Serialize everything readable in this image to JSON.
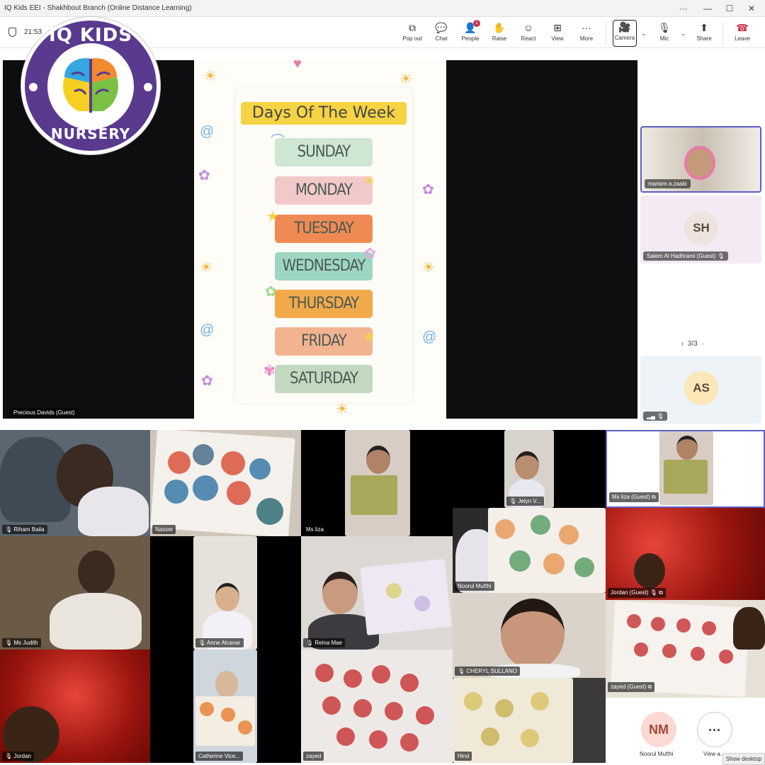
{
  "window": {
    "title": "IQ Kids EEI - Shakhbout Branch (Online Distance Learning)",
    "more": "···",
    "minimize": "—",
    "maximize": "☐",
    "close": "✕"
  },
  "meeting": {
    "time": "21:53"
  },
  "toolbar": {
    "popout": "Pop out",
    "chat": "Chat",
    "people": "People",
    "people_badge": "1",
    "raise": "Raise",
    "react": "React",
    "view": "View",
    "more": "More",
    "camera": "Camera",
    "mic": "Mic",
    "share": "Share",
    "leave": "Leave"
  },
  "logo": {
    "top": "IQ KIDS",
    "bottom": "NURSERY"
  },
  "slide": {
    "title": "Days Of The Week",
    "days": [
      "SUNDAY",
      "MONDAY",
      "TUESDAY",
      "WEDNESDAY",
      "THURSDAY",
      "FRIDAY",
      "SATURDAY"
    ],
    "day_colors": [
      "#cfe6d2",
      "#f2c9c9",
      "#f08a55",
      "#9dd6c3",
      "#f2a94a",
      "#f2b391",
      "#c2d9c0"
    ]
  },
  "stage": {
    "speaker": "Precious Davids (Guest)"
  },
  "right_panel": {
    "tile1": "mariam a.zaabi",
    "tile2_initials": "SH",
    "tile2_name": "Salem Al Hadhrami (Guest)",
    "pager": "3/3",
    "tile3_initials": "AS"
  },
  "grid": {
    "riham": "Riham Baila",
    "nasser": "Nasser",
    "msliza1": "Ms liza",
    "jelyn": "Jelyn V...",
    "msliza_guest": "Ms liza (Guest)",
    "msjudith": "Ms Judith",
    "anne": "Anne Alcanar",
    "reina": "Reina Mae",
    "noorul": "Noorul Mufthi",
    "jordan_guest": "Jordan (Guest)",
    "cheryl": "CHERYL SULLANO",
    "jordan": "Jordan",
    "catherine": "Catherine Vice...",
    "zayed": "zayed",
    "hind": "Hind",
    "zayed_guest": "zayed (Guest)"
  },
  "bottom": {
    "nm_initials": "NM",
    "nm_name": "Noorul Mufthi",
    "view_all": "View a...",
    "more_dots": "···",
    "show_desktop": "Show desktop"
  }
}
